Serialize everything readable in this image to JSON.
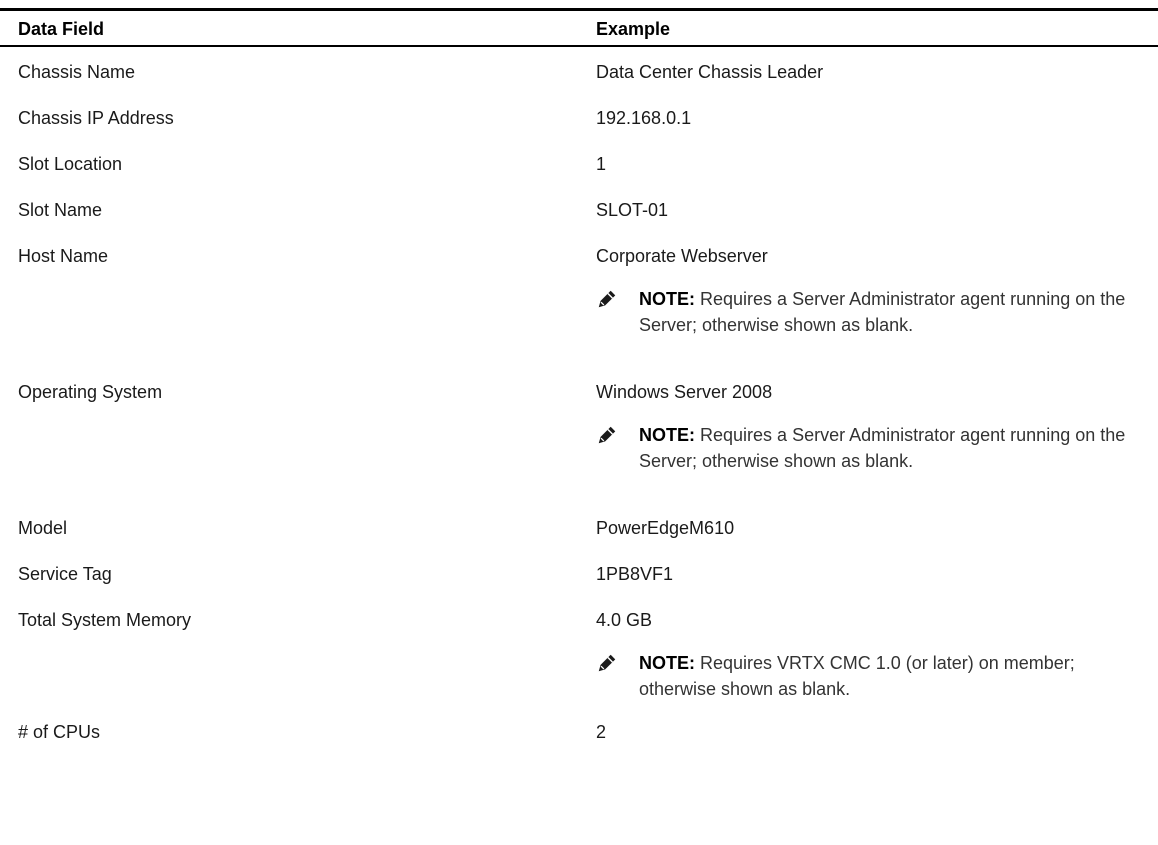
{
  "table": {
    "headers": {
      "field": "Data Field",
      "example": "Example"
    },
    "rows": [
      {
        "field": "Chassis Name",
        "example": "Data Center Chassis Leader"
      },
      {
        "field": "Chassis IP Address",
        "example": "192.168.0.1"
      },
      {
        "field": "Slot Location",
        "example": "1"
      },
      {
        "field": "Slot Name",
        "example": "SLOT-01"
      },
      {
        "field": "Host Name",
        "example": "Corporate Webserver",
        "note_label": "NOTE:",
        "note_text": "Requires a Server Administrator agent running on the Server; otherwise shown as blank."
      },
      {
        "field": "Operating System",
        "example": "Windows Server 2008",
        "note_label": "NOTE:",
        "note_text": "Requires a Server Administrator agent running on the Server; otherwise shown as blank."
      },
      {
        "field": "Model",
        "example": "PowerEdgeM610"
      },
      {
        "field": "Service Tag",
        "example": "1PB8VF1"
      },
      {
        "field": "Total System Memory",
        "example": "4.0 GB",
        "note_label": "NOTE:",
        "note_text": "Requires VRTX CMC 1.0 (or later) on member; otherwise shown as blank."
      },
      {
        "field": "# of CPUs",
        "example": "2"
      }
    ]
  },
  "icons": {
    "note": "pencil-note-icon"
  }
}
